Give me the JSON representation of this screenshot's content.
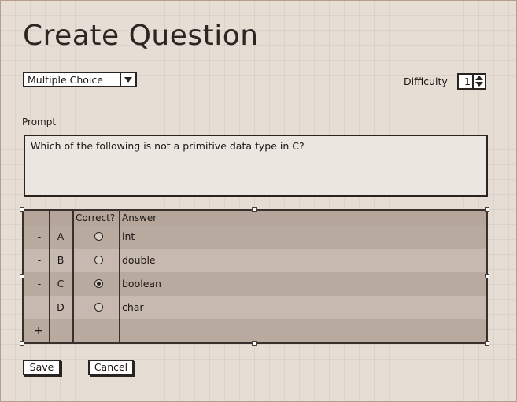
{
  "page": {
    "title": "Create Question"
  },
  "question_type": {
    "selected": "Multiple Choice"
  },
  "difficulty": {
    "label": "Difficulty",
    "value": "1"
  },
  "prompt": {
    "label": "Prompt",
    "text": "Which of the following is not a primitive data type in C?"
  },
  "answers_table": {
    "columns": [
      "",
      "",
      "Correct?",
      "Answer"
    ],
    "rows": [
      {
        "remove": "-",
        "letter": "A",
        "correct": false,
        "answer": "int"
      },
      {
        "remove": "-",
        "letter": "B",
        "correct": false,
        "answer": "double"
      },
      {
        "remove": "-",
        "letter": "C",
        "correct": true,
        "answer": "boolean"
      },
      {
        "remove": "-",
        "letter": "D",
        "correct": false,
        "answer": "char"
      }
    ],
    "add_label": "+"
  },
  "actions": {
    "save_label": "Save",
    "cancel_label": "Cancel"
  }
}
